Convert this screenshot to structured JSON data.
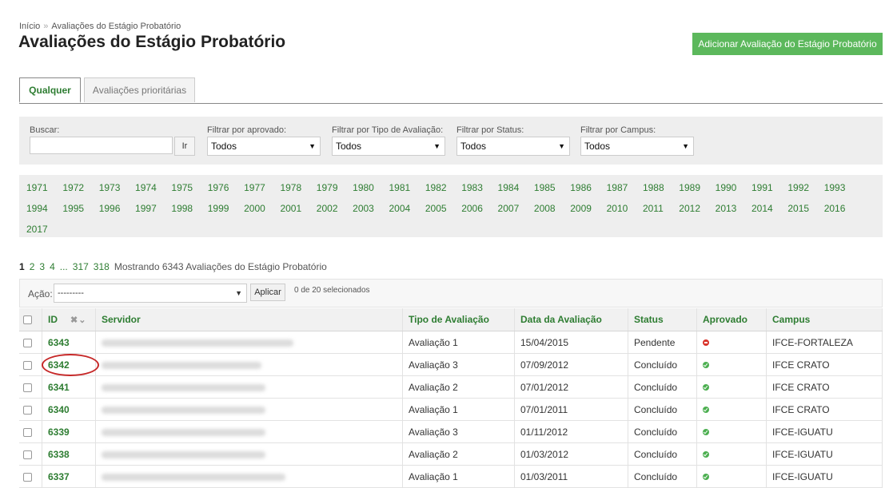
{
  "breadcrumb": {
    "home": "Início",
    "separator": "»",
    "current": "Avaliações do Estágio Probatório"
  },
  "page": {
    "title": "Avaliações do Estágio Probatório",
    "add_button": "Adicionar Avaliação do Estágio Probatório"
  },
  "tabs": [
    {
      "label": "Qualquer",
      "active": true
    },
    {
      "label": "Avaliações prioritárias",
      "active": false
    }
  ],
  "filters": {
    "search_label": "Buscar:",
    "search_value": "",
    "go_button": "Ir",
    "approved": {
      "label": "Filtrar por aprovado:",
      "value": "Todos"
    },
    "type": {
      "label": "Filtrar por Tipo de Avaliação:",
      "value": "Todos"
    },
    "status": {
      "label": "Filtrar por Status:",
      "value": "Todos"
    },
    "campus": {
      "label": "Filtrar por Campus:",
      "value": "Todos"
    }
  },
  "years": [
    "1971",
    "1972",
    "1973",
    "1974",
    "1975",
    "1976",
    "1977",
    "1978",
    "1979",
    "1980",
    "1981",
    "1982",
    "1983",
    "1984",
    "1985",
    "1986",
    "1987",
    "1988",
    "1989",
    "1990",
    "1991",
    "1992",
    "1993",
    "1994",
    "1995",
    "1996",
    "1997",
    "1998",
    "1999",
    "2000",
    "2001",
    "2002",
    "2003",
    "2004",
    "2005",
    "2006",
    "2007",
    "2008",
    "2009",
    "2010",
    "2011",
    "2012",
    "2013",
    "2014",
    "2015",
    "2016",
    "2017"
  ],
  "pagination": {
    "current": "1",
    "pages": [
      "2",
      "3",
      "4"
    ],
    "ellipsis": "...",
    "last_pages": [
      "317",
      "318"
    ],
    "summary": "Mostrando 6343 Avaliações do Estágio Probatório"
  },
  "actions": {
    "label": "Ação:",
    "select_value": "---------",
    "apply_button": "Aplicar",
    "selected_count": "0 de 20 selecionados"
  },
  "table": {
    "headers": {
      "id": "ID",
      "servidor": "Servidor",
      "tipo": "Tipo de Avaliação",
      "data": "Data da Avaliação",
      "status": "Status",
      "aprovado": "Aprovado",
      "campus": "Campus"
    },
    "rows": [
      {
        "id": "6343",
        "tipo": "Avaliação 1",
        "data": "15/04/2015",
        "status": "Pendente",
        "aprovado": "no",
        "campus": "IFCE-FORTALEZA"
      },
      {
        "id": "6342",
        "tipo": "Avaliação 3",
        "data": "07/09/2012",
        "status": "Concluído",
        "aprovado": "yes",
        "campus": "IFCE CRATO"
      },
      {
        "id": "6341",
        "tipo": "Avaliação 2",
        "data": "07/01/2012",
        "status": "Concluído",
        "aprovado": "yes",
        "campus": "IFCE CRATO"
      },
      {
        "id": "6340",
        "tipo": "Avaliação 1",
        "data": "07/01/2011",
        "status": "Concluído",
        "aprovado": "yes",
        "campus": "IFCE CRATO"
      },
      {
        "id": "6339",
        "tipo": "Avaliação 3",
        "data": "01/11/2012",
        "status": "Concluído",
        "aprovado": "yes",
        "campus": "IFCE-IGUATU"
      },
      {
        "id": "6338",
        "tipo": "Avaliação 2",
        "data": "01/03/2012",
        "status": "Concluído",
        "aprovado": "yes",
        "campus": "IFCE-IGUATU"
      },
      {
        "id": "6337",
        "tipo": "Avaliação 1",
        "data": "01/03/2011",
        "status": "Concluído",
        "aprovado": "yes",
        "campus": "IFCE-IGUATU"
      }
    ]
  },
  "colors": {
    "accent": "#2e7d32",
    "button_green": "#5cb85c",
    "highlight_circle": "#c62828"
  }
}
